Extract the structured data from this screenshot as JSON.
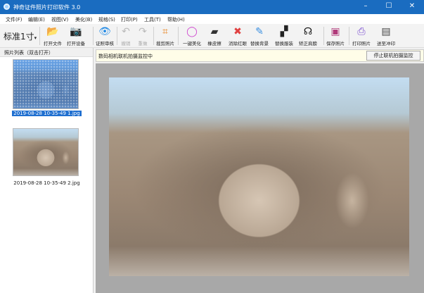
{
  "window": {
    "title": "神奇证件照片打印软件 3.0",
    "minimize": "–",
    "maximize": "☐",
    "close": "✕"
  },
  "menu": [
    "文件(F)",
    "编辑(E)",
    "视图(V)",
    "美化(B)",
    "规格(S)",
    "打印(P)",
    "工具(T)",
    "帮助(H)"
  ],
  "toolbar": {
    "spec": "标准1寸",
    "buttons": [
      {
        "label": "打开文件",
        "icon": "folder-open-icon",
        "glyph": "📂",
        "color": "#f0b030"
      },
      {
        "label": "打开设备",
        "icon": "camera-icon",
        "glyph": "📷",
        "color": "#1e88e5"
      },
      {
        "label": "证照审核",
        "icon": "eye-icon",
        "glyph": "👁",
        "color": "#1e88e5"
      },
      {
        "label": "撤销",
        "icon": "undo-icon",
        "glyph": "↶",
        "color": "#bbbbbb",
        "disabled": true
      },
      {
        "label": "重做",
        "icon": "redo-icon",
        "glyph": "↷",
        "color": "#bbbbbb",
        "disabled": true
      },
      {
        "label": "裁剪照片",
        "icon": "crop-icon",
        "glyph": "⌗",
        "color": "#e8821c"
      },
      {
        "label": "一键美化",
        "icon": "color-wheel-icon",
        "glyph": "◯",
        "color": "#d04bd0"
      },
      {
        "label": "橡皮擦",
        "icon": "eraser-icon",
        "glyph": "▰",
        "color": "#333333"
      },
      {
        "label": "消除红眼",
        "icon": "red-eye-icon",
        "glyph": "✖",
        "color": "#e04040"
      },
      {
        "label": "替换背景",
        "icon": "brush-icon",
        "glyph": "✎",
        "color": "#3a8fe0"
      },
      {
        "label": "替换服装",
        "icon": "suit-icon",
        "glyph": "▞",
        "color": "#222222"
      },
      {
        "label": "矫正肩膀",
        "icon": "head-icon",
        "glyph": "☊",
        "color": "#111111"
      },
      {
        "label": "保存照片",
        "icon": "save-icon",
        "glyph": "▣",
        "color": "#b03a7a"
      },
      {
        "label": "打印照片",
        "icon": "printer-icon",
        "glyph": "⎙",
        "color": "#7a4bd0"
      },
      {
        "label": "送至冲印",
        "icon": "photo-printer-icon",
        "glyph": "▤",
        "color": "#444444"
      }
    ]
  },
  "sidebar": {
    "title": "照片列表（双击打开）",
    "items": [
      {
        "name": "2019-08-28 10-35-49 1.jpg",
        "selected": true
      },
      {
        "name": "2019-08-28 10-35-49 2.jpg",
        "selected": false
      }
    ]
  },
  "status": {
    "text": "数码相机联机拍摄监控中",
    "stop_button": "停止联机拍摄监控"
  }
}
